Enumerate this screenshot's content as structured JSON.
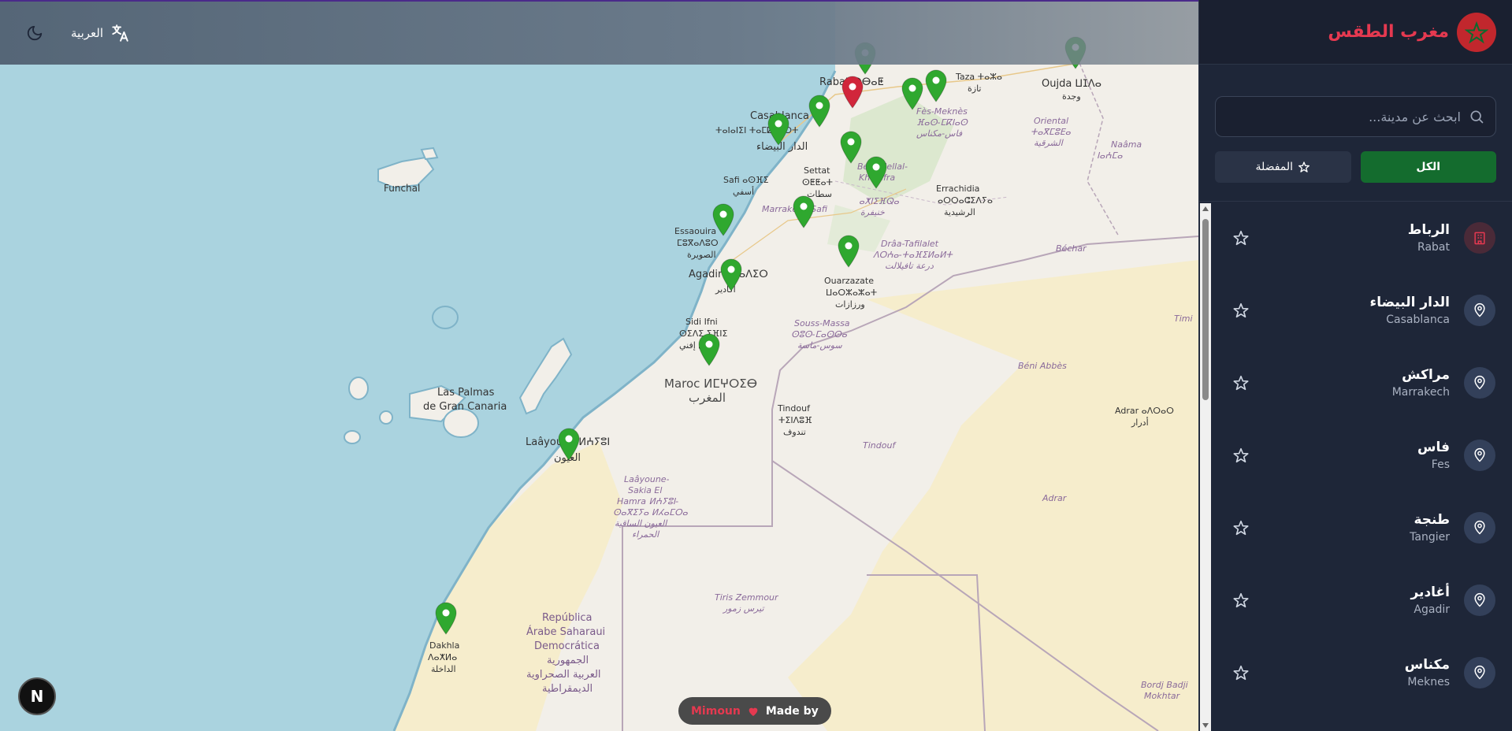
{
  "header": {
    "app_title": "مغرب الطقس",
    "language_label": "العربية"
  },
  "search": {
    "placeholder": "ابحث عن مدينة..."
  },
  "filters": {
    "all_label": "الكل",
    "favorites_label": "المفضلة"
  },
  "cities": [
    {
      "ar": "الرباط",
      "en": "Rabat",
      "active": true
    },
    {
      "ar": "الدار البيضاء",
      "en": "Casablanca"
    },
    {
      "ar": "مراكش",
      "en": "Marrakech"
    },
    {
      "ar": "فاس",
      "en": "Fes"
    },
    {
      "ar": "طنجة",
      "en": "Tangier"
    },
    {
      "ar": "أغادير",
      "en": "Agadir"
    },
    {
      "ar": "مكناس",
      "en": "Meknes"
    }
  ],
  "credit": {
    "made_by": "Made by",
    "author": "Mimoun"
  },
  "badge": {
    "letter": "N"
  },
  "map_labels": {
    "funchal": "Funchal",
    "las_palmas": "Las Palmas",
    "de_gran_canaria": "de Gran Canaria",
    "rabat": "Rabat ⵔⴱⴰⵟ",
    "oujda": "Oujda ⵡⵊⴷⴰ",
    "oujda_ar": "وجدة",
    "taza": "Taza ⵜⴰⵣⴰ",
    "taza_ar": "تازة",
    "casablanca": "Casablanca",
    "casablanca_tif": "ⵜⴰⵏⴰⵏⵉⵏ ⵜⴰⵎⵇⵇⵓⵔⵜ",
    "casablanca_ar": "الدار البيضاء",
    "fes_meknes": "Fès-Meknès",
    "fes_meknes_tif": "ⴼⴰⵙ-ⵎⴽⵏⴰⵙ",
    "fes_meknes_ar": "فاس-مكناس",
    "oriental": "Oriental",
    "oriental_tif": "ⵜⴰⴳⵎⵓⴹⴰ",
    "oriental_ar": "الشرقية",
    "naama": "Naâma",
    "naama_tif": "ⵏⴰⵄⵎⴰ",
    "naama_ar": "النعامة",
    "settat": "Settat",
    "settat_tif": "ⵙⵟⵟⴰⵜ",
    "settat_ar": "سطات",
    "safi": "Safi ⴰⵙⴼⵉ",
    "safi_ar": "أسفي",
    "errachidia": "Errachidia",
    "errachidia_tif": "ⴰⵔⵔⴰⵛⵉⴷⵢⴰ",
    "errachidia_ar": "الرشيدية",
    "essaouira": "Essaouira",
    "essaouira_tif": "ⵎⵓⴳⴰⴷⵓⵔ",
    "essaouira_ar": "الصويرة",
    "marrakech_safi": "Marrakech-Safi",
    "bechar": "Béchar",
    "draa": "Drâa-Tafilalet",
    "draa_tif": "ⴷⵔⵄⴰ-ⵜⴰⴼⵉⵍⴰⵍⵜ",
    "draa_ar": "درعة تافيلالت",
    "agadir": "Agadir ⴰⴳⴰⴷⵉⵔ",
    "agadir_ar": "أكادير",
    "ouarzazate": "Ouarzazate",
    "ouarzazate_tif": "ⵡⴰⵔⵣⴰⵣⴰⵜ",
    "ouarzazate_ar": "ورزازات",
    "sidi_ifni": "Sidi Ifni",
    "sidi_ifni_tif": "ⵙⵉⴷⵉ ⵉⴼⵏⵉ",
    "sidi_ifni_ar": "سيدي إفني",
    "souss": "Souss-Massa",
    "souss_tif": "ⵙⵓⵙ-ⵎⴰⵙⵙⴰ",
    "souss_ar": "سوس-ماسة",
    "timi": "Timi",
    "beni_abbes": "Béni Abbès",
    "maroc": "Maroc ⵍⵎⵖⵔⵉⴱ",
    "maroc_ar": "المغرب",
    "adrar_city": "Adrar ⴰⴷⵔⴰⵔ",
    "adrar_city_ar": "أدرار",
    "tindouf": "Tindouf",
    "tindouf_tif": "ⵜⵉⵏⴷⵓⴼ",
    "tindouf_ar": "تندوف",
    "tindouf_region": "Tindouf",
    "laayoune": "Laâyoune ⵍⵄⵢⵓⵏ",
    "laayoune_ar": "العيون",
    "laayoune_region": "Laâyoune-",
    "sakia_el": "Sakia El",
    "hamra": "Hamra ⵍⵄⵢⵓⵏ-",
    "saqia_tif": "ⵙⴰⴳⵉⵢⴰ ⵍⵃⴰⵎⵔⴰ",
    "laayoune_region_ar": "العيون الساقية",
    "hamra_ar": "الحمراء",
    "adrar_region": "Adrar",
    "tiris": "Tiris Zemmour",
    "tiris_ar": "تيرس زمور",
    "rasd_1": "República",
    "rasd_2": "Árabe Saharaui",
    "rasd_3": "Democrática",
    "rasd_ar1": "الجمهورية",
    "rasd_ar2": "العربية الصحراوية",
    "rasd_ar3": "الديمقراطية",
    "dakhla": "Dakhla",
    "dakhla_tif": "ⴷⴰⵅⵍⴰ",
    "dakhla_ar": "الداخلة",
    "bordj": "Bordj Badji",
    "mokhtar": "Mokhtar",
    "beni_mellal": "Béni Mellal-",
    "khenifra": "Khénifra",
    "beni_mellal_ar": "بني ملال",
    "khenifra_tif": "ⴰⵅⵏⵉⴼⵕⴰ",
    "khenifra_ar": "خنيفرة"
  }
}
